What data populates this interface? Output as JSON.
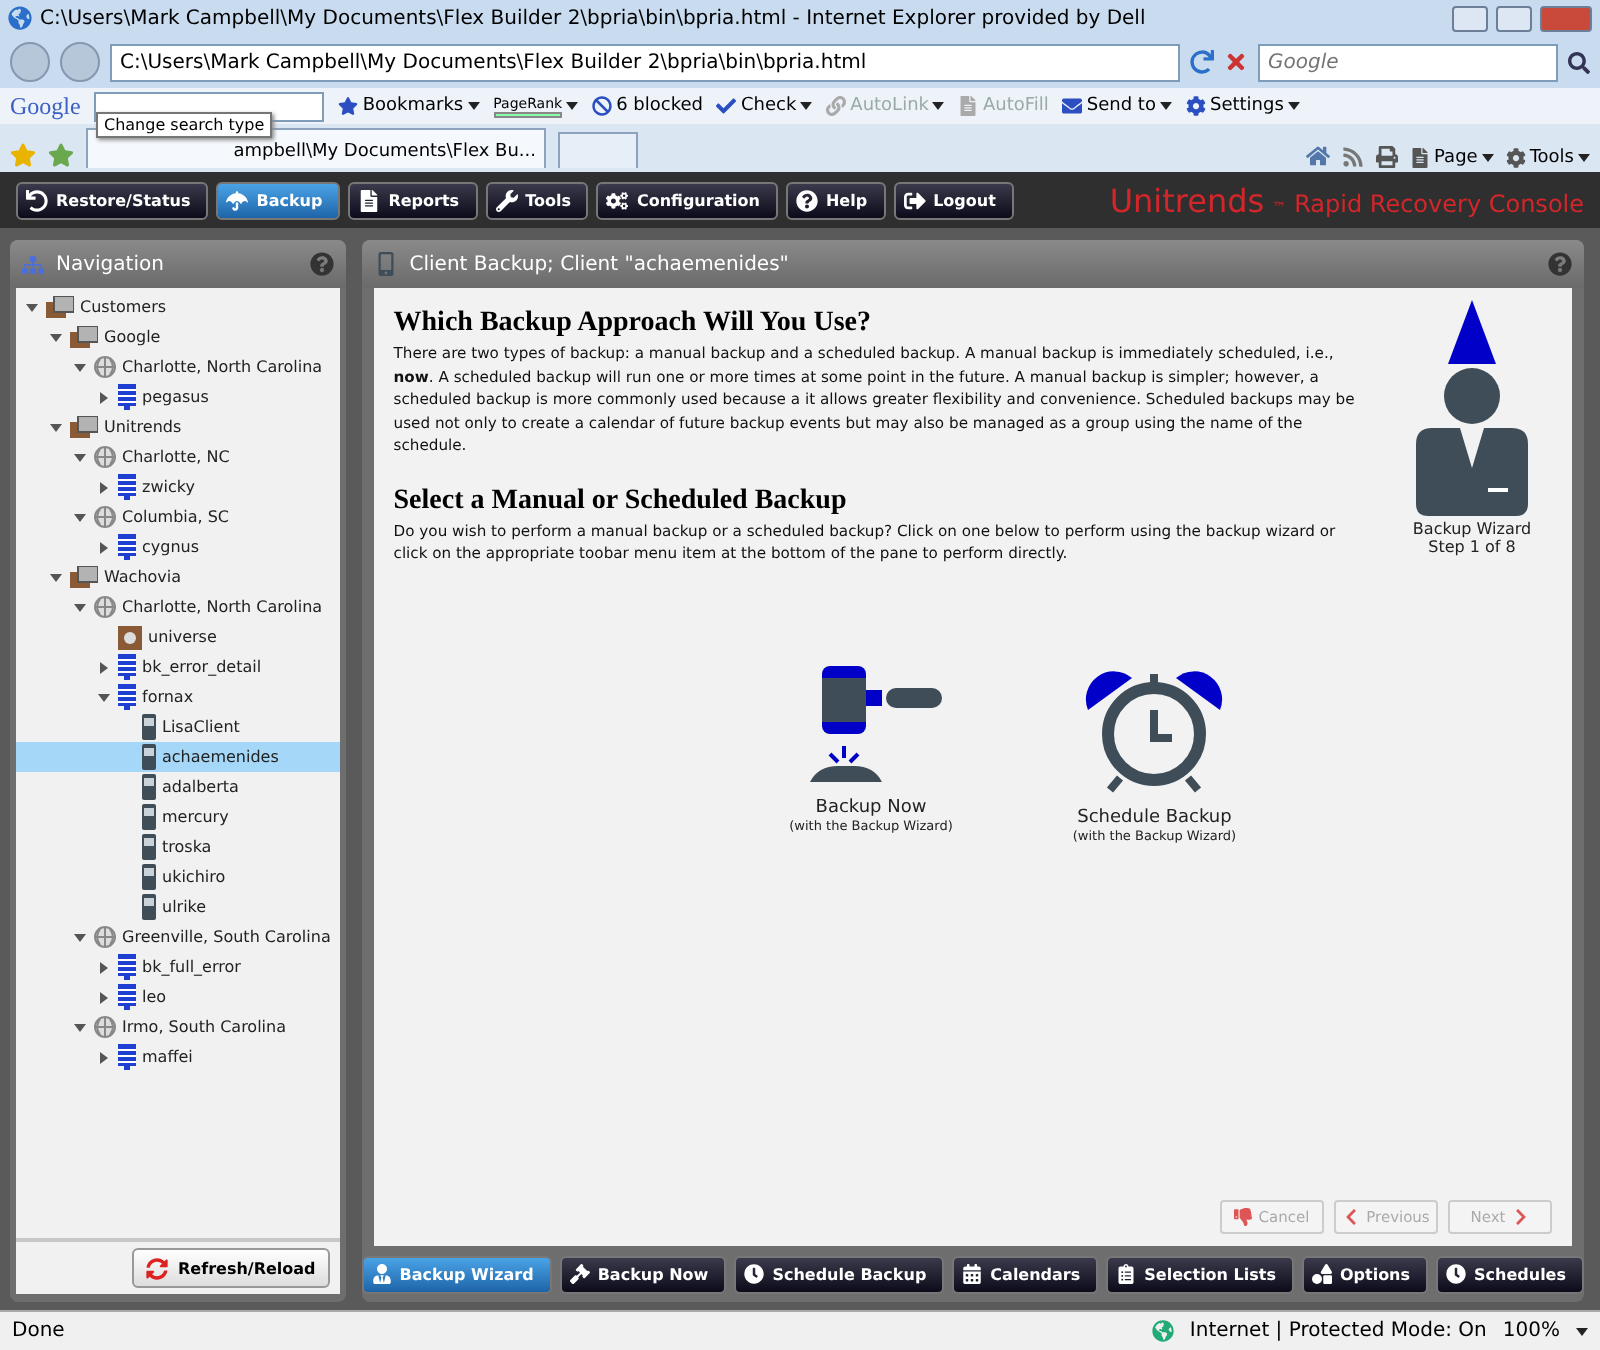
{
  "window": {
    "title": "C:\\Users\\Mark Campbell\\My Documents\\Flex Builder 2\\bpria\\bin\\bpria.html - Internet Explorer provided by Dell"
  },
  "address_bar": {
    "url": "C:\\Users\\Mark Campbell\\My Documents\\Flex Builder 2\\bpria\\bin\\bpria.html"
  },
  "search": {
    "placeholder": "Google"
  },
  "google_toolbar": {
    "logo": "Google",
    "items": [
      {
        "label": "Bookmarks",
        "kind": "menu",
        "disabled": false
      },
      {
        "label": "PageRank",
        "kind": "pagerank",
        "disabled": false
      },
      {
        "label": "6 blocked",
        "kind": "button",
        "disabled": false
      },
      {
        "label": "Check",
        "kind": "menu",
        "disabled": false
      },
      {
        "label": "AutoLink",
        "kind": "menu",
        "disabled": true
      },
      {
        "label": "AutoFill",
        "kind": "button",
        "disabled": true
      },
      {
        "label": "Send to",
        "kind": "menu",
        "disabled": false
      },
      {
        "label": "Settings",
        "kind": "menu",
        "disabled": false
      }
    ]
  },
  "tooltip": "Change search type",
  "tab": {
    "title": "ampbell\\My Documents\\Flex Bu..."
  },
  "command_bar": [
    "Page",
    "Tools"
  ],
  "app_nav": [
    {
      "label": "Restore/Status",
      "selected": false
    },
    {
      "label": "Backup",
      "selected": true
    },
    {
      "label": "Reports",
      "selected": false
    },
    {
      "label": "Tools",
      "selected": false
    },
    {
      "label": "Configuration",
      "selected": false
    },
    {
      "label": "Help",
      "selected": false
    },
    {
      "label": "Logout",
      "selected": false
    }
  ],
  "brand": {
    "name": "Unitrends",
    "mark": "™",
    "tagline": "Rapid Recovery Console"
  },
  "navigation": {
    "title": "Navigation",
    "tree": [
      {
        "label": "Customers",
        "kind": "group",
        "expanded": true,
        "selected": false,
        "children": [
          {
            "label": "Google",
            "kind": "group",
            "expanded": true,
            "selected": false,
            "children": [
              {
                "label": "Charlotte, North Carolina",
                "kind": "site",
                "expanded": true,
                "selected": false,
                "children": [
                  {
                    "label": "pegasus",
                    "kind": "server",
                    "expanded": false,
                    "selected": false
                  }
                ]
              }
            ]
          },
          {
            "label": "Unitrends",
            "kind": "group",
            "expanded": true,
            "selected": false,
            "children": [
              {
                "label": "Charlotte, NC",
                "kind": "site",
                "expanded": true,
                "selected": false,
                "children": [
                  {
                    "label": "zwicky",
                    "kind": "server",
                    "expanded": false,
                    "selected": false
                  }
                ]
              },
              {
                "label": "Columbia, SC",
                "kind": "site",
                "expanded": true,
                "selected": false,
                "children": [
                  {
                    "label": "cygnus",
                    "kind": "server",
                    "expanded": false,
                    "selected": false
                  }
                ]
              }
            ]
          },
          {
            "label": "Wachovia",
            "kind": "group",
            "expanded": true,
            "selected": false,
            "children": [
              {
                "label": "Charlotte, North Carolina",
                "kind": "site",
                "expanded": true,
                "selected": false,
                "children": [
                  {
                    "label": "universe",
                    "kind": "appliance",
                    "selected": false
                  },
                  {
                    "label": "bk_error_detail",
                    "kind": "server",
                    "expanded": false,
                    "selected": false
                  },
                  {
                    "label": "fornax",
                    "kind": "server",
                    "expanded": true,
                    "selected": false,
                    "children": [
                      {
                        "label": "LisaClient",
                        "kind": "client",
                        "selected": false
                      },
                      {
                        "label": "achaemenides",
                        "kind": "client",
                        "selected": true
                      },
                      {
                        "label": "adalberta",
                        "kind": "client",
                        "selected": false
                      },
                      {
                        "label": "mercury",
                        "kind": "client",
                        "selected": false
                      },
                      {
                        "label": "troska",
                        "kind": "client",
                        "selected": false
                      },
                      {
                        "label": "ukichiro",
                        "kind": "client",
                        "selected": false
                      },
                      {
                        "label": "ulrike",
                        "kind": "client",
                        "selected": false
                      }
                    ]
                  }
                ]
              },
              {
                "label": "Greenville, South Carolina",
                "kind": "site",
                "expanded": true,
                "selected": false,
                "children": [
                  {
                    "label": "bk_full_error",
                    "kind": "server",
                    "expanded": false,
                    "selected": false
                  },
                  {
                    "label": "leo",
                    "kind": "server",
                    "expanded": false,
                    "selected": false
                  }
                ]
              },
              {
                "label": "Irmo, South Carolina",
                "kind": "site",
                "expanded": true,
                "selected": false,
                "children": [
                  {
                    "label": "maffei",
                    "kind": "server",
                    "expanded": false,
                    "selected": false
                  }
                ]
              }
            ]
          }
        ]
      }
    ],
    "refresh_button": "Refresh/Reload"
  },
  "content": {
    "title": "Client Backup; Client \"achaemenides\"",
    "heading_1": "Which Backup Approach Will You Use?",
    "paragraph_1": "There are two types of backup: a manual backup and a scheduled backup.  A manual backup is immediately scheduled, i.e., **now**. A scheduled backup will run one or more times at some point in the future. A manual backup is simpler; however, a scheduled backup is more commonly used because a it allows greater flexibility and convenience.  Scheduled backups may be used not only to create a calendar of future backup events but may also be managed as a group using the name of the schedule.",
    "heading_2": "Select a Manual or Scheduled Backup",
    "paragraph_2": "Do you wish to perform a manual backup or a scheduled backup?  Click on one below to perform using the backup wizard or click on the appropriate toobar menu item at the bottom of the pane to perform directly.",
    "wizard": {
      "title": "Backup Wizard",
      "step": "Step 1 of 8"
    },
    "choices": [
      {
        "label": "Backup Now",
        "note": "(with the Backup Wizard)"
      },
      {
        "label": "Schedule Backup",
        "note": "(with the Backup Wizard)"
      }
    ],
    "wizard_buttons": [
      {
        "label": "Cancel",
        "disabled": true
      },
      {
        "label": "Previous",
        "disabled": true
      },
      {
        "label": "Next",
        "disabled": true
      }
    ]
  },
  "bottom_toolbar": [
    {
      "label": "Backup Wizard",
      "selected": true
    },
    {
      "label": "Backup Now",
      "selected": false
    },
    {
      "label": "Schedule Backup",
      "selected": false
    },
    {
      "label": "Calendars",
      "selected": false
    },
    {
      "label": "Selection Lists",
      "selected": false
    },
    {
      "label": "Options",
      "selected": false
    },
    {
      "label": "Schedules",
      "selected": false
    }
  ],
  "status_bar": {
    "text": "Done",
    "zone": "Internet | Protected Mode: On",
    "zoom": "100%"
  }
}
